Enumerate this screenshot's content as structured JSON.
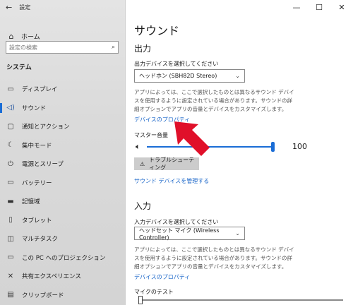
{
  "window": {
    "title": "設定",
    "back_icon": "back-arrow-icon",
    "controls": [
      "minimize",
      "maximize",
      "close"
    ]
  },
  "sidebar": {
    "home_label": "ホーム",
    "search_placeholder": "設定の検索",
    "section": "システム",
    "items": [
      {
        "label": "ディスプレイ",
        "icon": "display-icon",
        "active": false
      },
      {
        "label": "サウンド",
        "icon": "sound-icon",
        "active": true
      },
      {
        "label": "通知とアクション",
        "icon": "notification-icon",
        "active": false
      },
      {
        "label": "集中モード",
        "icon": "focus-moon-icon",
        "active": false
      },
      {
        "label": "電源とスリープ",
        "icon": "power-icon",
        "active": false
      },
      {
        "label": "バッテリー",
        "icon": "battery-icon",
        "active": false
      },
      {
        "label": "記憶域",
        "icon": "storage-icon",
        "active": false
      },
      {
        "label": "タブレット",
        "icon": "tablet-icon",
        "active": false
      },
      {
        "label": "マルチタスク",
        "icon": "multitask-icon",
        "active": false
      },
      {
        "label": "この PC へのプロジェクション",
        "icon": "projection-icon",
        "active": false
      },
      {
        "label": "共有エクスペリエンス",
        "icon": "shared-icon",
        "active": false
      },
      {
        "label": "クリップボード",
        "icon": "clipboard-icon",
        "active": false
      }
    ]
  },
  "main": {
    "title": "サウンド",
    "output": {
      "heading": "出力",
      "select_label": "出力デバイスを選択してください",
      "selected_device": "ヘッドホン (SBH82D Stereo)",
      "description": "アプリによっては、ここで選択したものとは異なるサウンド デバイスを使用するように設定されている場合があります。サウンドの詳細オプションでアプリの音量とデバイスをカスタマイズします。",
      "device_properties": "デバイスのプロパティ",
      "master_volume_label": "マスター音量",
      "volume": "100",
      "troubleshoot": "トラブルシューティング",
      "manage_devices": "サウンド デバイスを管理する"
    },
    "input": {
      "heading": "入力",
      "select_label": "入力デバイスを選択してください",
      "selected_device": "ヘッドセット マイク (Wireless Controller)",
      "description": "アプリによっては、ここで選択したものとは異なるサウンド デバイスを使用するように設定されている場合があります。サウンドの詳細オプションでアプリの音量とデバイスをカスタマイズします。",
      "device_properties": "デバイスのプロパティ",
      "mic_test_label": "マイクのテスト"
    }
  },
  "colors": {
    "accent": "#1a6dd6",
    "link": "#1a66c9",
    "annotation_arrow": "#e0102a"
  }
}
